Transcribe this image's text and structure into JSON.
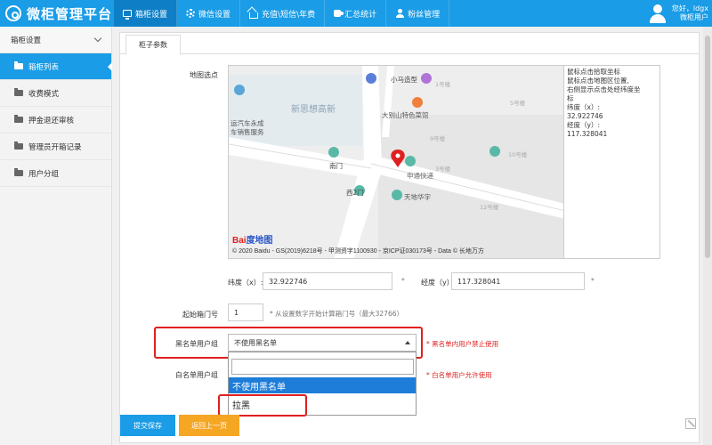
{
  "app": {
    "title": "微柜管理平台"
  },
  "nav": [
    {
      "label": "箱柜设置",
      "icon": "monitor-icon"
    },
    {
      "label": "微信设置",
      "icon": "gear-icon"
    },
    {
      "label": "充值\\短信\\年费",
      "icon": "house-icon"
    },
    {
      "label": "汇总统计",
      "icon": "puzzle-icon"
    },
    {
      "label": "粉丝管理",
      "icon": "user-icon"
    }
  ],
  "user": {
    "greeting": "您好，ldgx",
    "role": "微柜用户"
  },
  "sidebar": {
    "header": "箱柜设置",
    "items": [
      {
        "label": "箱柜列表",
        "active": true
      },
      {
        "label": "收费模式"
      },
      {
        "label": "押金退还审核"
      },
      {
        "label": "管理员开箱记录"
      },
      {
        "label": "用户分组"
      }
    ]
  },
  "tab": {
    "label": "柜子参数"
  },
  "form": {
    "map_label": "地图选点",
    "map_hint_lines": [
      "鼠标点击拾取坐标",
      "鼠标点击地图区位置,",
      "右侧显示点击处经纬度坐",
      "标"
    ],
    "map_lat_line": "纬度（x）:",
    "map_lat_value": "32.922746",
    "map_lng_line": "经度（y）:",
    "map_lng_value": "117.328041",
    "lat_label": "纬度（x）:",
    "lat_value": "32.922746",
    "lng_label": "经度（y）:",
    "lng_value": "117.328041",
    "star": "*",
    "start_label": "起始箱门号",
    "start_value": "1",
    "start_hint": "* 从设置数字开始计算箱门号（最大32766）",
    "black_label": "黑名单用户组",
    "black_selected": "不使用黑名单",
    "black_hint": "* 黑名单内用户禁止使用",
    "white_label": "白名单用户组",
    "white_hint": "* 白名单用户允许使用",
    "dropdown_options": [
      "不使用黑名单",
      "拉黑"
    ],
    "save_button": "提交保存",
    "back_button": "返回上一页"
  },
  "map": {
    "labels": {
      "xiaoma": "小马造型",
      "dabieshan": "大别山特色菜馆",
      "xinsi": "新思想高新",
      "yunqiche": "运汽车永成",
      "cheshou": "车销售服务",
      "nanmen": "南门",
      "shentong": "申通快递",
      "xi2men": "西2门",
      "tiandi": "天地华宇",
      "b1": "1号楼",
      "b2": "5号楼",
      "b3": "9号楼",
      "b4": "10号楼",
      "b5": "12号楼",
      "b6": "3号楼"
    },
    "copyright": "© 2020 Baidu - GS(2019)6218号 - 甲测资字1100930 - 京ICP证030173号 - Data © 长地万方",
    "logo_bai": "Bai",
    "logo_du": "度地图"
  },
  "colors": {
    "brand": "#1a9ce6",
    "highlight": "#e02020",
    "save": "#1a9ce6",
    "back": "#f5a623"
  }
}
